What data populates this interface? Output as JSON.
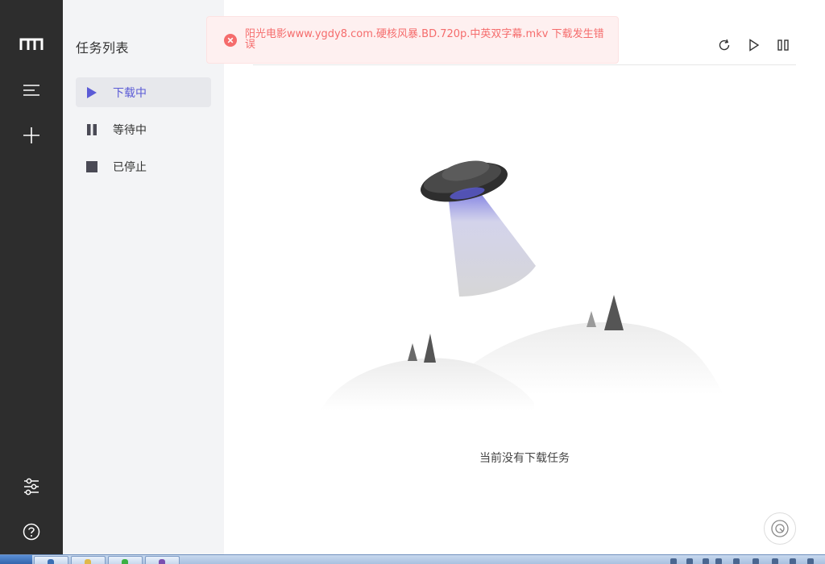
{
  "sidebar": {
    "title": "任务列表",
    "items": [
      {
        "label": "下载中",
        "icon": "play-icon",
        "active": true
      },
      {
        "label": "等待中",
        "icon": "pause-icon",
        "active": false
      },
      {
        "label": "已停止",
        "icon": "stop-icon",
        "active": false
      }
    ]
  },
  "rail": {
    "icons": [
      "app-logo-icon",
      "menu-icon",
      "add-icon",
      "settings-sliders-icon",
      "help-icon"
    ]
  },
  "toolbar": {
    "icons": [
      "refresh-icon",
      "resume-all-icon",
      "pause-all-icon"
    ]
  },
  "toast": {
    "type": "error",
    "icon": "error-circle-icon",
    "message": "阳光电影www.ygdy8.com.硬核风暴.BD.720p.中英双字幕.mkv 下载发生错误"
  },
  "empty_state": {
    "text": "当前没有下载任务"
  },
  "colors": {
    "accent": "#5b5bd6",
    "rail_bg": "#2d2d2d",
    "sidebar_bg": "#f3f4f6",
    "error_text": "#f56c6c",
    "error_bg": "#fef0f0"
  }
}
